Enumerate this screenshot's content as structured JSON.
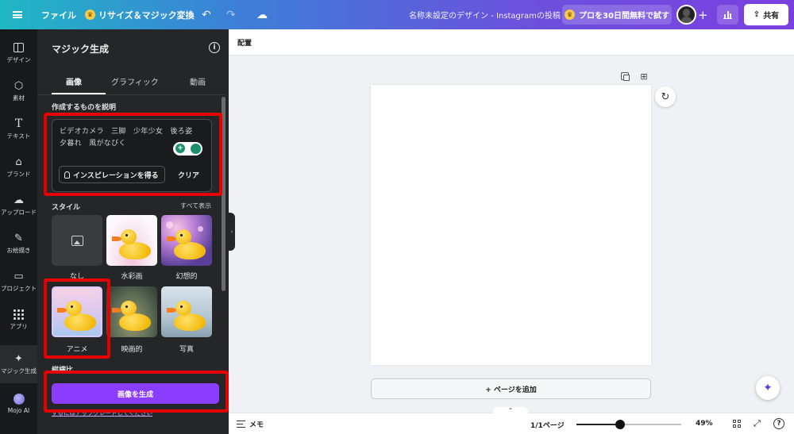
{
  "header": {
    "file_label": "ファイル",
    "resize_label": "リサイズ＆マジック変換",
    "doc_title": "名称未設定のデザイン - Instagramの投稿",
    "pro_label": "プロを30日間無料で試す",
    "share_label": "共有",
    "icons": [
      "menu-icon",
      "crown-icon",
      "undo-icon",
      "redo-icon",
      "cloud-icon",
      "plus-icon",
      "analytics-icon",
      "share-icon"
    ]
  },
  "rail": {
    "items": [
      {
        "label": "デザイン",
        "icon": "layout-icon"
      },
      {
        "label": "素材",
        "icon": "shapes-icon"
      },
      {
        "label": "テキスト",
        "icon": "text-icon"
      },
      {
        "label": "ブランド",
        "icon": "brand-icon"
      },
      {
        "label": "アップロード",
        "icon": "upload-icon"
      },
      {
        "label": "お絵描き",
        "icon": "draw-icon"
      },
      {
        "label": "プロジェクト",
        "icon": "folder-icon"
      },
      {
        "label": "アプリ",
        "icon": "apps-icon"
      },
      {
        "label": "マジック生成",
        "icon": "magic-icon",
        "active": true
      },
      {
        "label": "Mojo AI",
        "icon": "mojo-icon"
      }
    ]
  },
  "panel": {
    "title": "マジック生成",
    "tabs": [
      {
        "label": "画像",
        "active": true
      },
      {
        "label": "グラフィック"
      },
      {
        "label": "動画"
      }
    ],
    "describe_label": "作成するものを説明",
    "prompt_text": "ビデオカメラ　三脚　少年少女　後ろ姿　夕暮れ　風がなびく",
    "inspiration_label": "インスピレーションを得る",
    "clear_label": "クリア",
    "style_label": "スタイル",
    "see_all_label": "すべて表示",
    "styles": [
      {
        "label": "なし"
      },
      {
        "label": "水彩画"
      },
      {
        "label": "幻想的"
      },
      {
        "label": "アニメ",
        "selected": true
      },
      {
        "label": "映画的"
      },
      {
        "label": "写真"
      }
    ],
    "aspect_label": "縦横比",
    "generate_label": "画像を生成",
    "upgrade_note": "するにはアップグレードしてください",
    "accent_color": "#8b3dff",
    "annotation_color": "#e60000"
  },
  "canvas": {
    "layout_label": "配置",
    "add_page_label": "+ ページを追加"
  },
  "status": {
    "memo_label": "メモ",
    "page_count": "1/1ページ",
    "zoom_label": "49%",
    "zoom_fraction": 0.42
  }
}
